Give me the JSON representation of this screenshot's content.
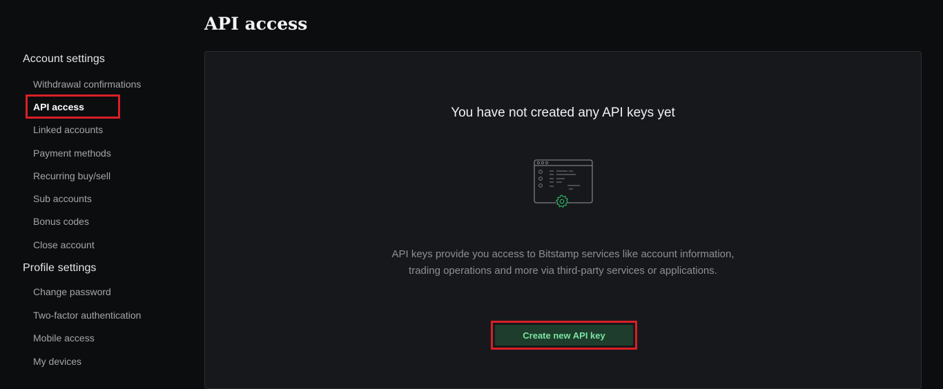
{
  "page": {
    "title": "API access"
  },
  "sidebar": {
    "account_section": {
      "title": "Account settings",
      "items": [
        {
          "label": "Withdrawal confirmations"
        },
        {
          "label": "API access"
        },
        {
          "label": "Linked accounts"
        },
        {
          "label": "Payment methods"
        },
        {
          "label": "Recurring buy/sell"
        },
        {
          "label": "Sub accounts"
        },
        {
          "label": "Bonus codes"
        },
        {
          "label": "Close account"
        }
      ]
    },
    "profile_section": {
      "title": "Profile settings",
      "items": [
        {
          "label": "Change password"
        },
        {
          "label": "Two-factor authentication"
        },
        {
          "label": "Mobile access"
        },
        {
          "label": "My devices"
        }
      ]
    }
  },
  "main": {
    "empty_state": {
      "title": "You have not created any API keys yet",
      "illustration_icon": "browser-settings-icon",
      "description_line1": "API keys provide you access to Bitstamp services like account information,",
      "description_line2": "trading operations and more via third-party services or applications."
    },
    "create_button_label": "Create new API key"
  },
  "colors": {
    "background": "#0c0d0f",
    "card": "#17181b",
    "accent_green": "#2eb86b",
    "button_bg": "#1e3d2c",
    "button_text": "#7be3a5",
    "highlight_red": "#d91f26"
  }
}
